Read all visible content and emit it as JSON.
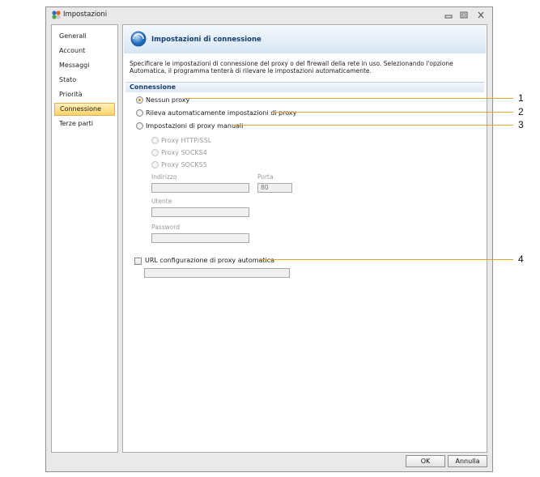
{
  "window": {
    "title": "Impostazioni"
  },
  "sidebar": {
    "items": [
      {
        "label": "Generali"
      },
      {
        "label": "Account"
      },
      {
        "label": "Messaggi"
      },
      {
        "label": "Stato"
      },
      {
        "label": "Priorità"
      },
      {
        "label": "Connessione",
        "selected": true
      },
      {
        "label": "Terze parti"
      }
    ]
  },
  "header": {
    "title": "Impostazioni di connessione",
    "description": "Specificare le impostazioni di connessione del proxy o del firewall della rete in uso.  Selezionando l'opzione Automatica, il programma tenterà di rilevare le impostazioni automaticamente."
  },
  "section": {
    "title": "Connessione"
  },
  "options": {
    "no_proxy": "Nessun proxy",
    "auto_detect": "Rileva automaticamente impostazioni di proxy",
    "manual": "Impostazioni di proxy manuali",
    "selected": "no_proxy"
  },
  "manual": {
    "types": [
      "Proxy HTTP/SSL",
      "Proxy SOCKS4",
      "Proxy SOCKS5"
    ],
    "address_label": "Indirizzo",
    "address_value": "",
    "port_label": "Porta",
    "port_value": "80",
    "user_label": "Utente",
    "user_value": "",
    "password_label": "Password",
    "password_value": ""
  },
  "auto_config": {
    "label": "URL configurazione di proxy automatica",
    "checked": false,
    "value": ""
  },
  "buttons": {
    "ok": "OK",
    "cancel": "Annulla"
  },
  "callouts": [
    "1",
    "2",
    "3",
    "4"
  ],
  "colors": {
    "accent": "#ffd36a",
    "header_text": "#173d73",
    "callout_line": "#e4a728"
  }
}
